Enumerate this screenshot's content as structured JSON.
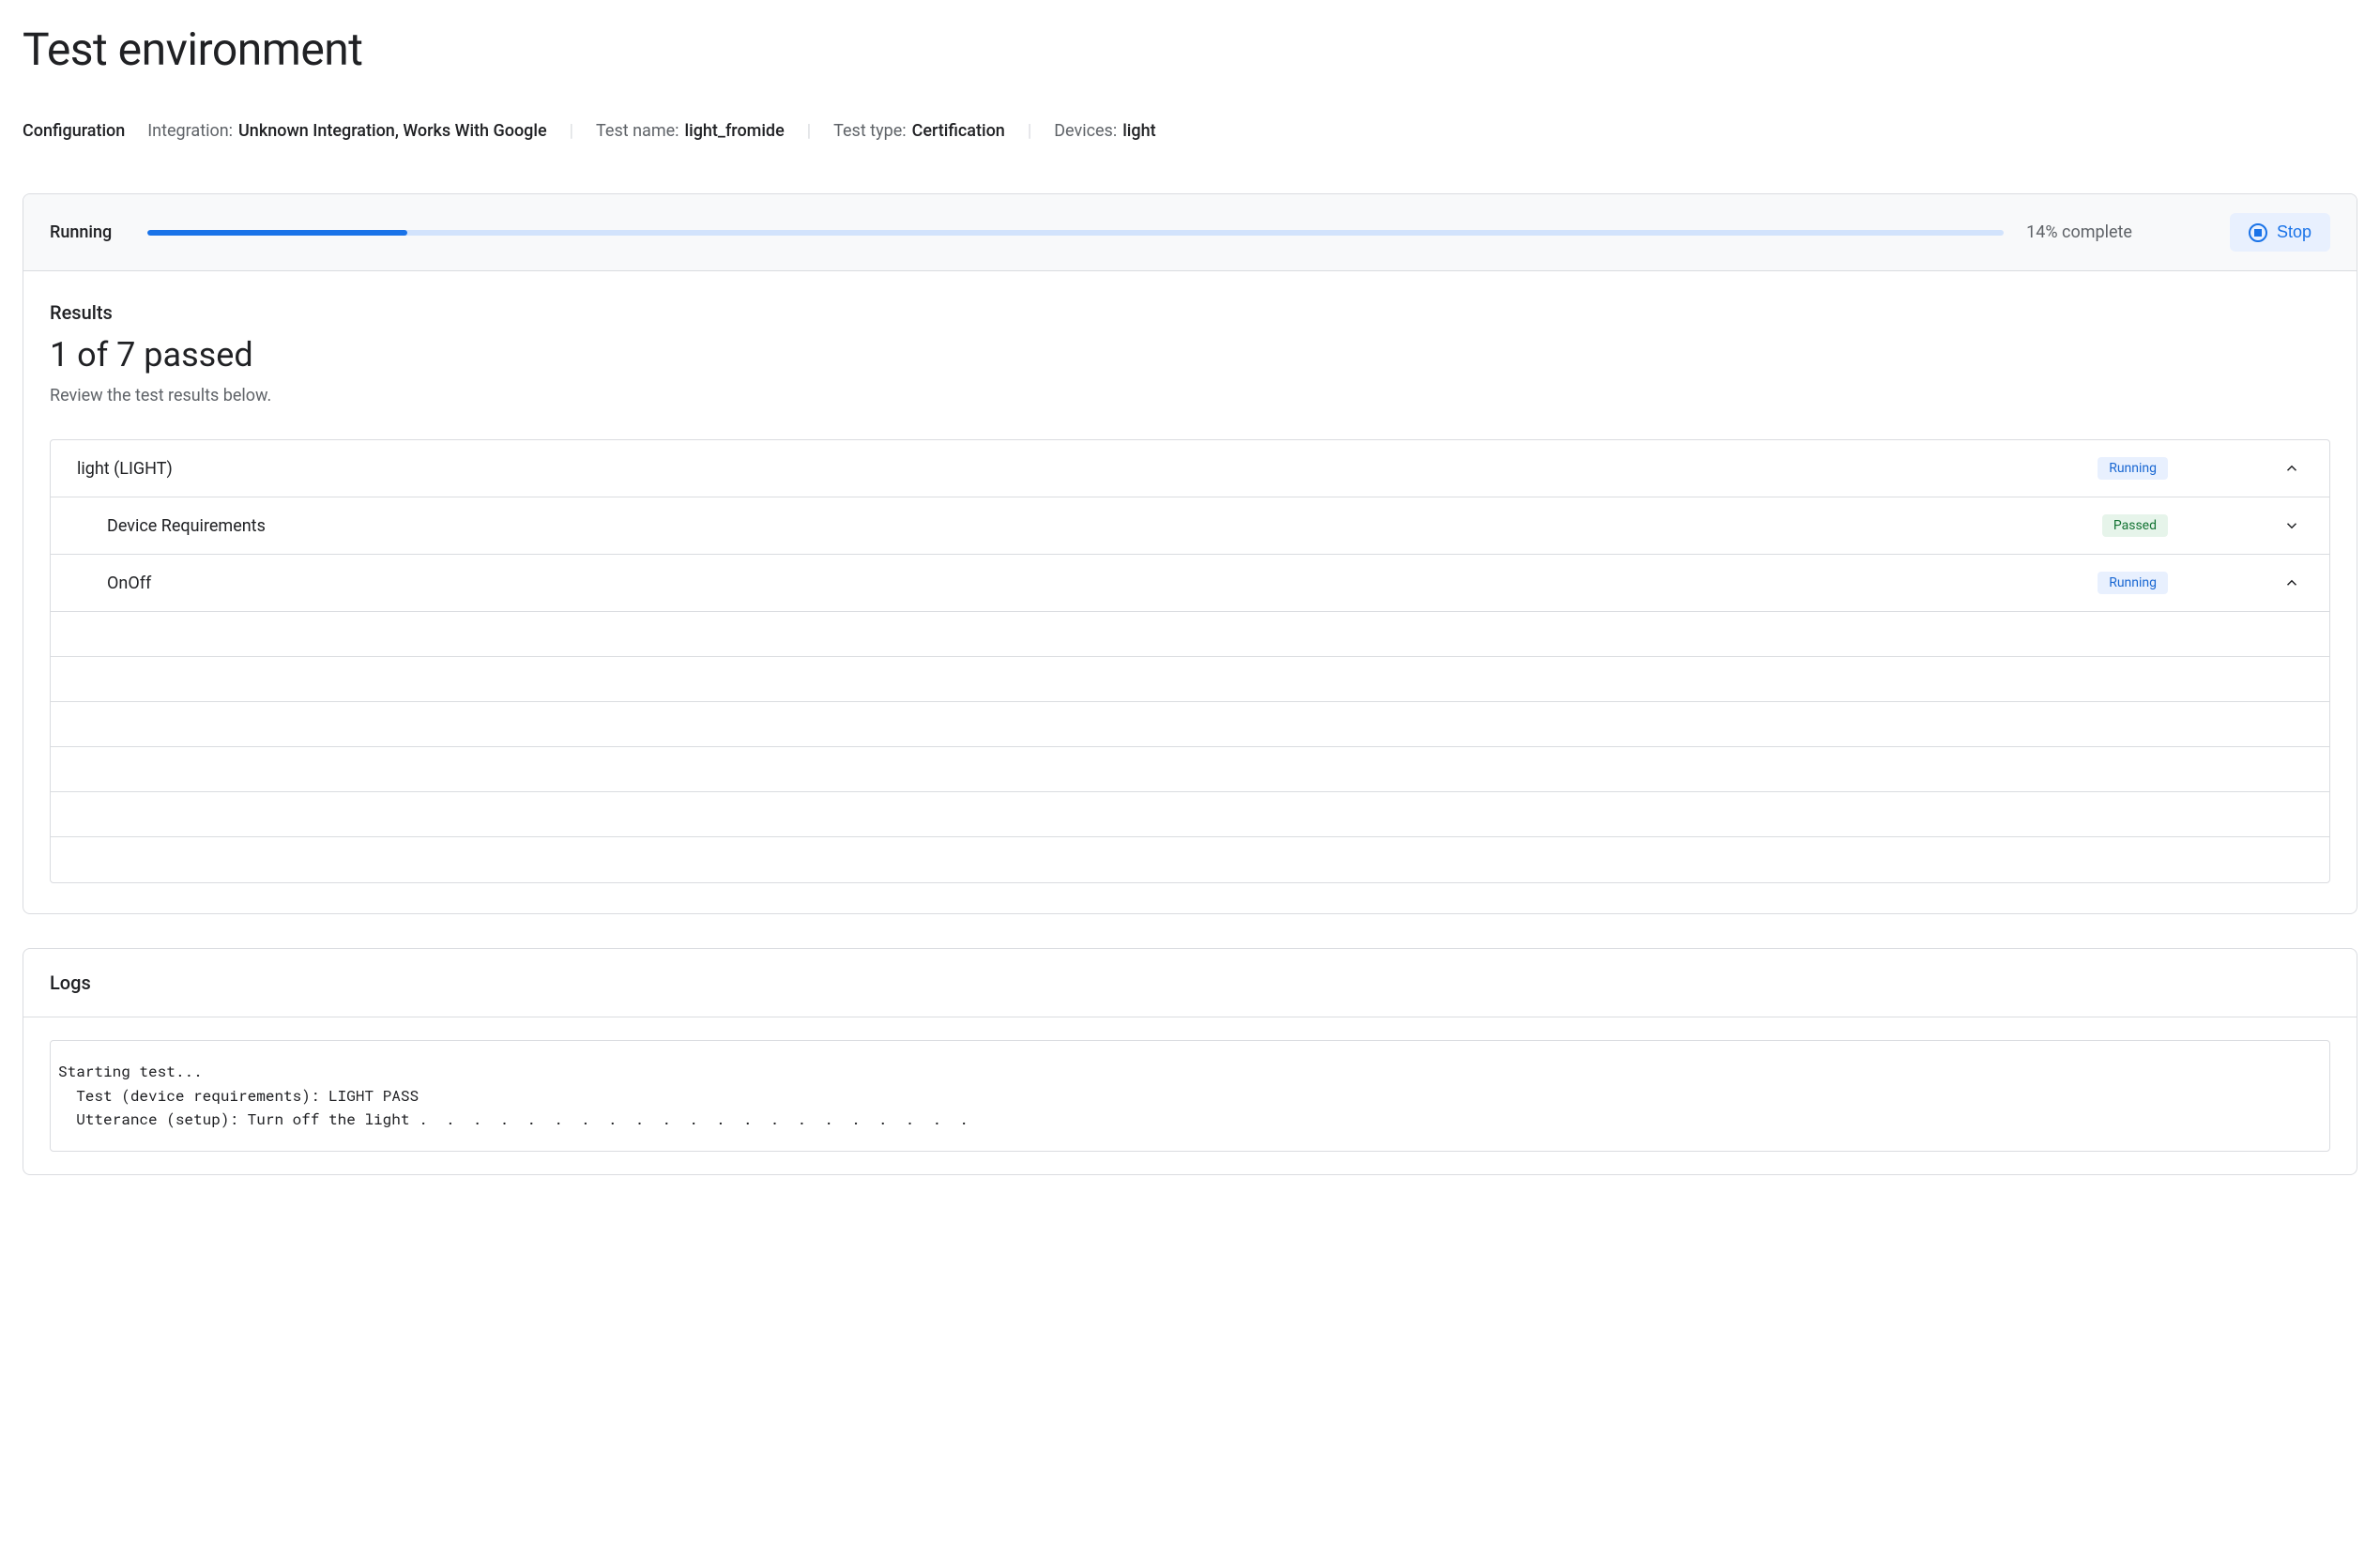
{
  "page": {
    "title": "Test environment"
  },
  "config": {
    "label": "Configuration",
    "integration_label": "Integration:",
    "integration_value": "Unknown Integration, Works With Google",
    "test_name_label": "Test name:",
    "test_name_value": "light_fromide",
    "test_type_label": "Test type:",
    "test_type_value": "Certification",
    "devices_label": "Devices:",
    "devices_value": "light"
  },
  "status": {
    "label": "Running",
    "progress_percent": 14,
    "progress_text": "14% complete",
    "stop_label": "Stop"
  },
  "results": {
    "title": "Results",
    "summary": "1 of 7 passed",
    "subtitle": "Review the test results below.",
    "rows": [
      {
        "name": "light (LIGHT)",
        "badge": "Running",
        "badge_type": "running",
        "expanded": true,
        "indent": 0
      },
      {
        "name": "Device Requirements",
        "badge": "Passed",
        "badge_type": "passed",
        "expanded": false,
        "indent": 1
      },
      {
        "name": "OnOff",
        "badge": "Running",
        "badge_type": "running",
        "expanded": true,
        "indent": 1
      }
    ]
  },
  "logs": {
    "title": "Logs",
    "content": "Starting test...\n  Test (device requirements): LIGHT PASS\n  Utterance (setup): Turn off the light .  .  .  .  .  .  .  .  .  .  .  .  .  .  .  .  .  .  .  .  ."
  }
}
